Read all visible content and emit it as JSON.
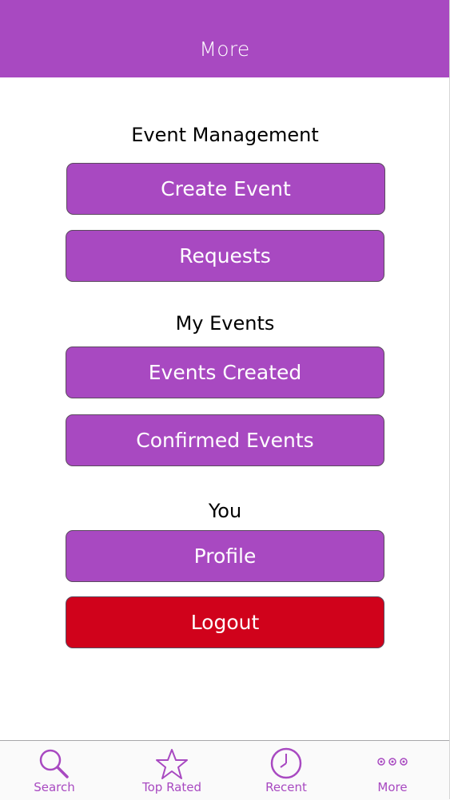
{
  "nav": {
    "title": "More"
  },
  "sections": [
    {
      "title": "Event Management"
    },
    {
      "title": "My Events"
    },
    {
      "title": "You"
    }
  ],
  "buttons": {
    "create_event": "Create Event",
    "requests": "Requests",
    "events_created": "Events Created",
    "confirmed_events": "Confirmed Events",
    "profile": "Profile",
    "logout": "Logout"
  },
  "tabs": [
    {
      "label": "Search",
      "icon": "search-icon"
    },
    {
      "label": "Top Rated",
      "icon": "star-icon"
    },
    {
      "label": "Recent",
      "icon": "clock-icon"
    },
    {
      "label": "More",
      "icon": "more-icon"
    }
  ],
  "colors": {
    "accent": "#a849c1",
    "danger": "#d0021b"
  }
}
